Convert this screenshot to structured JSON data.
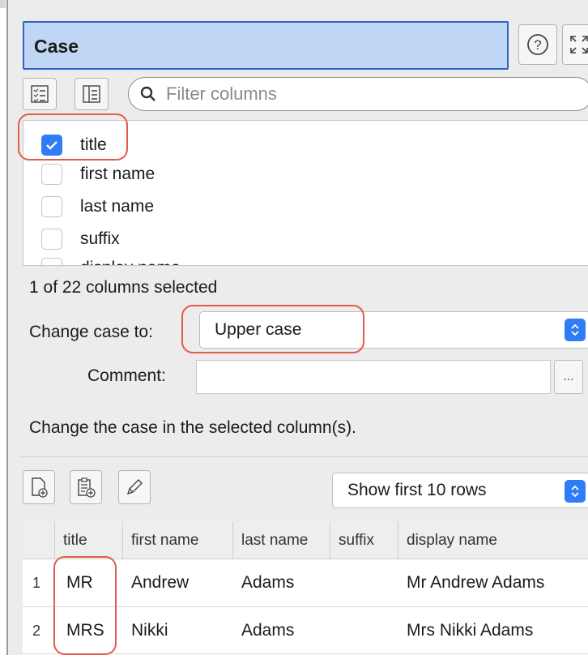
{
  "panel": {
    "title": "Case"
  },
  "filter": {
    "placeholder": "Filter columns"
  },
  "columns": [
    {
      "label": "title",
      "checked": true
    },
    {
      "label": "first name",
      "checked": false
    },
    {
      "label": "last name",
      "checked": false
    },
    {
      "label": "suffix",
      "checked": false
    },
    {
      "label": "display name",
      "checked": false
    }
  ],
  "selection_count": "1 of 22 columns selected",
  "change_case": {
    "label": "Change case to:",
    "value": "Upper case"
  },
  "comment": {
    "label": "Comment:",
    "value": "",
    "button": "..."
  },
  "description": "Change the case in the selected column(s).",
  "preview": {
    "rows_select": "Show first 10 rows",
    "headers": [
      "title",
      "first name",
      "last name",
      "suffix",
      "display name"
    ],
    "rows": [
      {
        "num": "1",
        "cells": [
          "MR",
          "Andrew",
          "Adams",
          "",
          "Mr Andrew Adams"
        ]
      },
      {
        "num": "2",
        "cells": [
          "MRS",
          "Nikki",
          "Adams",
          "",
          "Mrs Nikki Adams"
        ]
      }
    ]
  },
  "colors": {
    "accent": "#2e7cf6",
    "title_bg": "#bfd7f4",
    "highlight": "#e35b4b"
  }
}
